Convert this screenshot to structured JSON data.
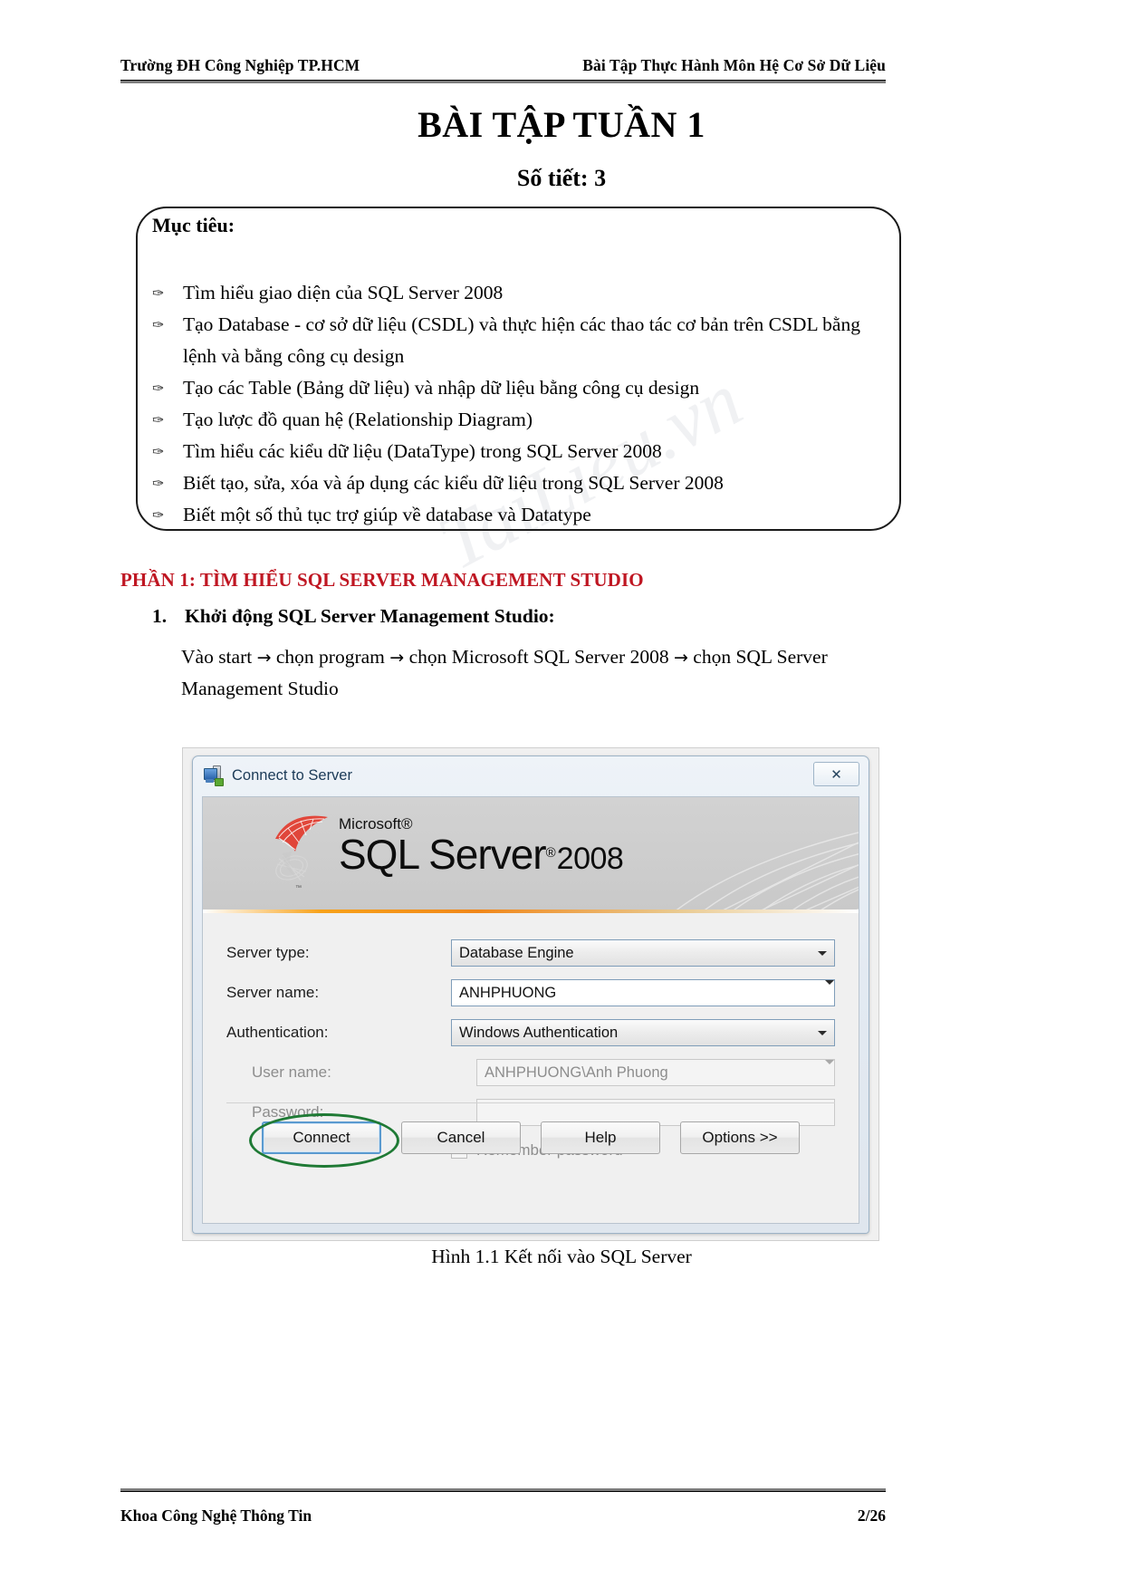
{
  "header": {
    "left": "Trường ĐH Công Nghiệp TP.HCM",
    "right": "Bài Tập Thực Hành Môn Hệ Cơ Sở Dữ Liệu"
  },
  "title": {
    "main": "BÀI TẬP TUẦN 1",
    "sub": "Số tiết: 3"
  },
  "objective": {
    "heading": "Mục tiêu:",
    "bullet_glyph": "✑",
    "items": [
      "Tìm hiểu giao diện của SQL Server 2008",
      "Tạo Database - cơ sở dữ liệu (CSDL) và thực hiện các thao tác cơ bản trên CSDL bằng lệnh và bằng công cụ design",
      "Tạo các Table (Bảng dữ liệu) và nhập dữ liệu bằng công cụ design",
      "Tạo lược đồ quan hệ (Relationship Diagram)",
      "Tìm hiểu các kiểu dữ liệu (DataType) trong SQL Server 2008",
      "Biết tạo, sửa, xóa và áp dụng các kiểu dữ liệu trong SQL Server 2008",
      "Biết một số thủ tục trợ giúp về database và Datatype"
    ]
  },
  "part": {
    "heading": "PHẦN 1: TÌM HIỂU SQL SERVER MANAGEMENT STUDIO",
    "heading_color": "#bf1622",
    "item_number": "1.",
    "item_title": "Khởi động SQL Server Management Studio:",
    "paragraph_1": "Vào start",
    "paragraph_2": "chọn program",
    "paragraph_3": "chọn Microsoft SQL Server 2008",
    "paragraph_4": "chọn SQL Server Management Studio",
    "arrow_glyph": "→"
  },
  "dialog": {
    "title": "Connect to Server",
    "icon": "server-connect-icon",
    "close_glyph": "✕",
    "banner": {
      "brand_small": "Microsoft",
      "registered": "®",
      "product": "SQL Server",
      "trademark": "®",
      "year": "2008"
    },
    "fields": [
      {
        "label": "Server type:",
        "value": "Database Engine",
        "control": "combo",
        "disabled": false
      },
      {
        "label": "Server name:",
        "value": "ANHPHUONG",
        "control": "combo-edit",
        "disabled": false
      },
      {
        "label": "Authentication:",
        "value": "Windows Authentication",
        "control": "combo",
        "disabled": false
      },
      {
        "label": "User name:",
        "value": "ANHPHUONG\\Anh Phuong",
        "control": "combo-edit",
        "disabled": true
      },
      {
        "label": "Password:",
        "value": "",
        "control": "text",
        "disabled": true
      }
    ],
    "checkbox": {
      "label": "Remember password",
      "checked": false
    },
    "buttons": [
      {
        "label": "Connect",
        "default": true,
        "highlighted": true
      },
      {
        "label": "Cancel",
        "default": false,
        "highlighted": false
      },
      {
        "label": "Help",
        "default": false,
        "highlighted": false
      },
      {
        "label": "Options >>",
        "default": false,
        "highlighted": false
      }
    ],
    "highlight_color": "#1f7a35"
  },
  "caption": "Hình 1.1 Kết nối vào SQL Server",
  "footer": {
    "left": "Khoa Công Nghệ Thông Tin",
    "right": "2/26"
  },
  "watermark": "TaiLieu.vn"
}
